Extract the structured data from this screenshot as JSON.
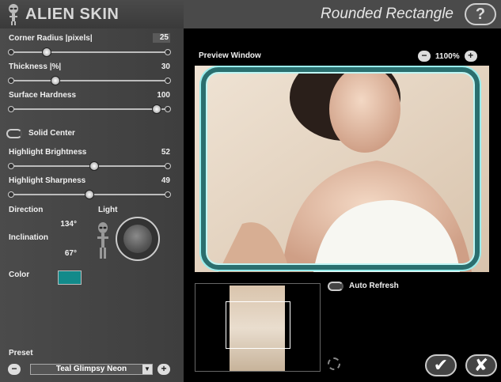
{
  "header": {
    "brand": "ALIEN SKIN",
    "filter_title": "Rounded Rectangle",
    "help_label": "?"
  },
  "controls": {
    "corner_radius": {
      "label": "Corner Radius |pixels|",
      "value": "25",
      "fraction": 0.22
    },
    "thickness": {
      "label": "Thickness |%|",
      "value": "30",
      "fraction": 0.28
    },
    "surface_hardness": {
      "label": "Surface Hardness",
      "value": "100",
      "fraction": 0.94
    },
    "solid_center": {
      "label": "Solid Center"
    },
    "highlight_brightness": {
      "label": "Highlight Brightness",
      "value": "52",
      "fraction": 0.53
    },
    "highlight_sharpness": {
      "label": "Highlight Sharpness",
      "value": "49",
      "fraction": 0.5
    },
    "direction": {
      "label": "Direction",
      "value": "134°"
    },
    "inclination": {
      "label": "Inclination",
      "value": "67°"
    },
    "light_label": "Light",
    "color": {
      "label": "Color",
      "hex": "#128a8a"
    }
  },
  "preset": {
    "label": "Preset",
    "selected": "Teal Glimpsy Neon",
    "minus": "−",
    "plus": "+"
  },
  "preview": {
    "label": "Preview Window",
    "zoom": "1100%",
    "zoom_minus": "−",
    "zoom_plus": "+",
    "auto_refresh_label": "Auto Refresh"
  },
  "actions": {
    "ok": "✔",
    "cancel": "✘"
  }
}
